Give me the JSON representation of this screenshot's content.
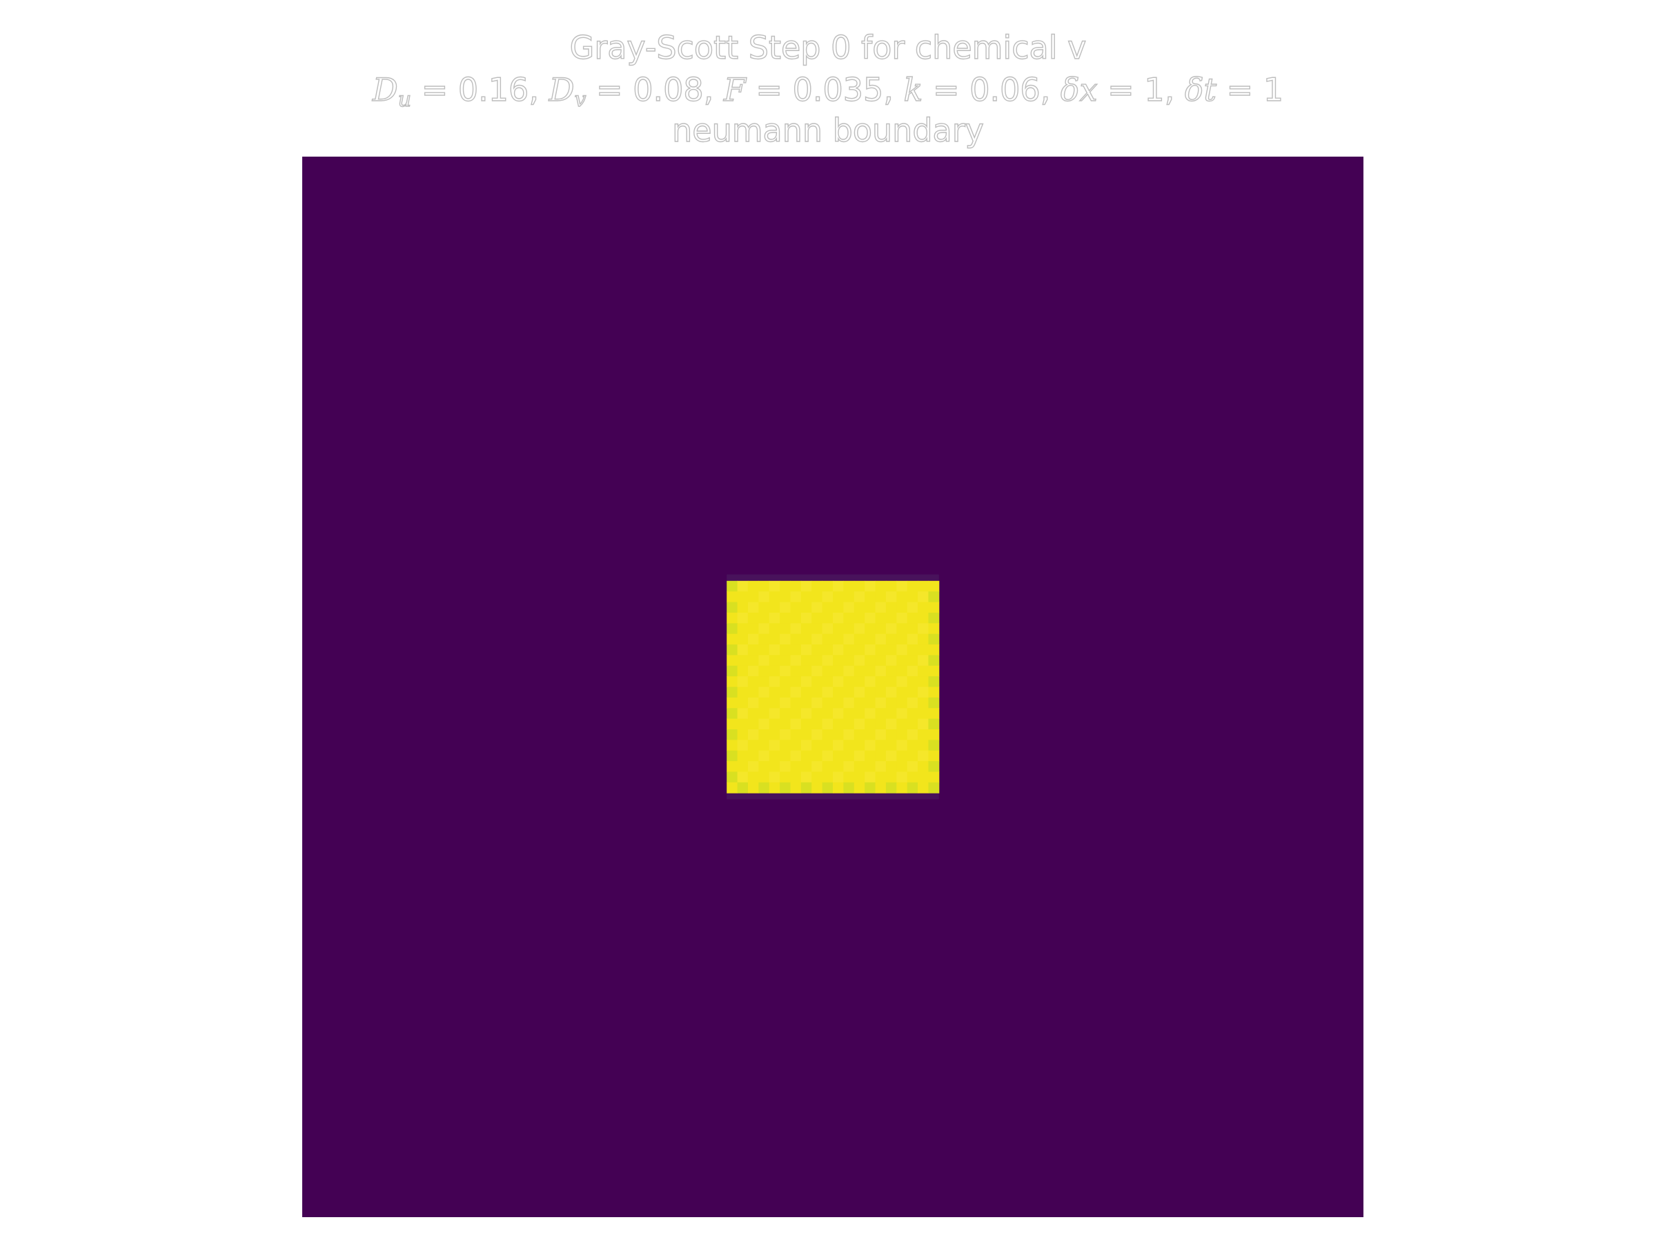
{
  "chart_data": {
    "type": "heatmap",
    "title": "Gray-Scott Step 0 for chemical v",
    "title_chemical": "v",
    "subtitle": {
      "Du": "0.16",
      "Dv": "0.08",
      "F": "0.035",
      "k": "0.06",
      "dx": "1",
      "dt": "1"
    },
    "subtitle_text": "D_u = 0.16, D_v = 0.08, F = 0.035, k = 0.06, δx = 1, δt = 1",
    "boundary_label": "neumann boundary",
    "step": 0,
    "chemical": "v",
    "grid_size": [
      100,
      100
    ],
    "axes_visible": false,
    "colormap": "viridis",
    "value_range": [
      0,
      0.25
    ],
    "background_value": 0,
    "patch": {
      "rows": [
        40,
        60
      ],
      "cols": [
        40,
        60
      ],
      "value": 0.25,
      "border_value": 0.02
    },
    "colors": {
      "background": "#440154",
      "patch": "#f2e51c",
      "patch_light": "#f5e72a",
      "patch_edge": "#d9e021",
      "border": "#48125b"
    }
  }
}
